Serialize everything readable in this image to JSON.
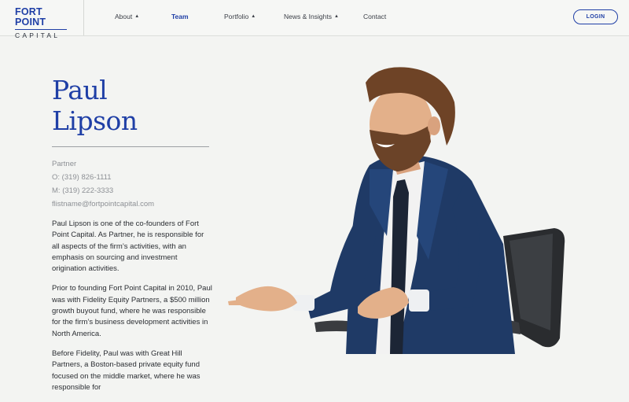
{
  "brand": {
    "line1": "FORT POINT",
    "line2": "CAPITAL"
  },
  "nav": {
    "items": [
      {
        "label": "About",
        "chevron": true,
        "active": false
      },
      {
        "label": "Team",
        "chevron": false,
        "active": true
      },
      {
        "label": "Portfolio",
        "chevron": true,
        "active": false
      },
      {
        "label": "News & Insights",
        "chevron": true,
        "active": false
      },
      {
        "label": "Contact",
        "chevron": false,
        "active": false
      }
    ],
    "login_label": "LOGIN"
  },
  "profile": {
    "first_name": "Paul",
    "last_name": "Lipson",
    "title": "Partner",
    "office": "O: (319) 826-1111",
    "mobile": "M: (319) 222-3333",
    "email": "flistname@fortpointcapital.com",
    "bio": [
      "Paul Lipson is one of the co-founders of Fort Point Capital. As Partner, he is responsible for all aspects of the firm’s activities, with an emphasis on sourcing and investment origination activities.",
      "Prior to founding Fort Point Capital in 2010, Paul was with Fidelity Equity Partners, a $500 million growth buyout fund, where he was responsible for the firm’s business development activities in North America.",
      "Before Fidelity, Paul was with Great Hill Partners, a Boston-based private equity fund focused on the middle market, where he was responsible for"
    ]
  },
  "colors": {
    "accent": "#1f3fa6",
    "background": "#f3f4f2",
    "text": "#2b2e33",
    "muted": "#8d9095"
  },
  "icons": {
    "nav_chevron": "chevron-up-icon"
  }
}
